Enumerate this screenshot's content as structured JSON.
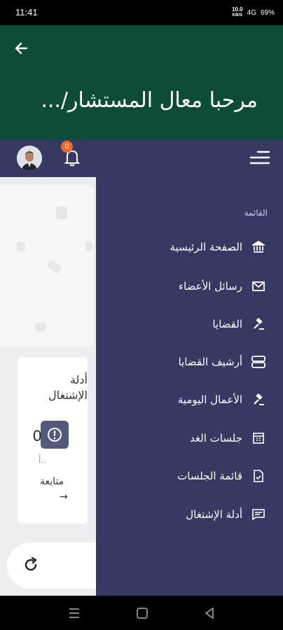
{
  "status": {
    "time": "11:41",
    "net_top": "10.0",
    "net_bottom": "KB/S",
    "signal": "4G",
    "battery": "69%"
  },
  "header": {
    "title": "مرحبا معال المستشار/..."
  },
  "navbar": {
    "notification_count": "0"
  },
  "drawer": {
    "section_title": "القائمة",
    "items": [
      {
        "label": "الصفحة الرئيسية",
        "icon": "bank-icon"
      },
      {
        "label": "رسائل الأعضاء",
        "icon": "mail-icon"
      },
      {
        "label": "القضايا",
        "icon": "gavel-icon"
      },
      {
        "label": "أرشيف القضايا",
        "icon": "archive-icon"
      },
      {
        "label": "الأعمال اليومية",
        "icon": "gavel-icon"
      },
      {
        "label": "جلسات الغد",
        "icon": "calendar-icon"
      },
      {
        "label": "قائمة الجلسات",
        "icon": "document-icon"
      },
      {
        "label": "أدلة الإشتغال",
        "icon": "note-icon"
      }
    ]
  },
  "card": {
    "title": "أدلة الإشتغال",
    "count": "0",
    "sub": "أ..",
    "action": "متابعة",
    "arrow": "→"
  },
  "colors": {
    "header": "#0d4d38",
    "navbar": "#363a63",
    "badge": "#f06a2e"
  }
}
